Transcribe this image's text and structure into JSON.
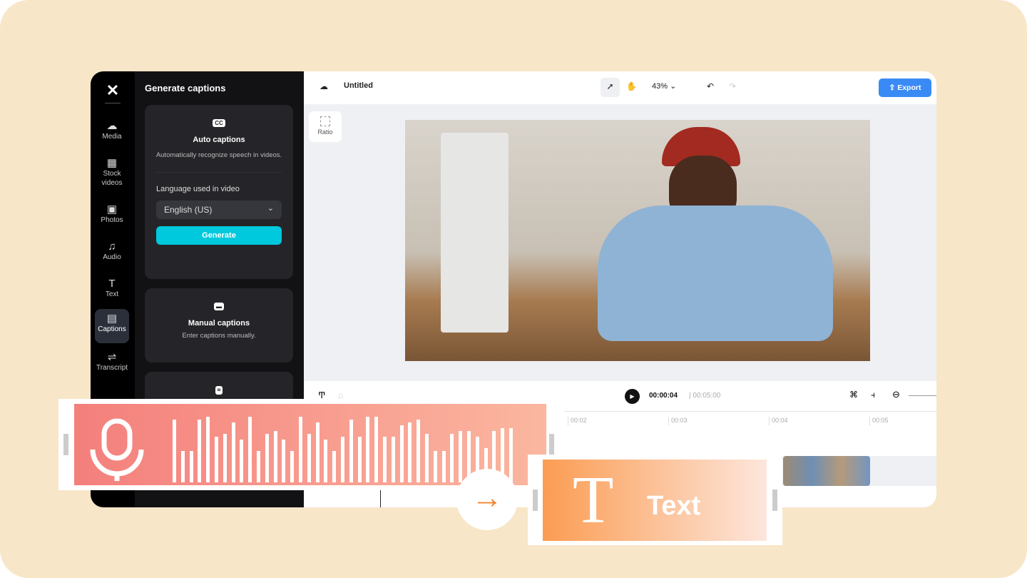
{
  "sidebar": {
    "items": [
      {
        "label": "Media",
        "icon": "cloud-upload-icon"
      },
      {
        "label": "Stock videos",
        "icon": "film-icon"
      },
      {
        "label": "Photos",
        "icon": "image-icon"
      },
      {
        "label": "Audio",
        "icon": "music-icon"
      },
      {
        "label": "Text",
        "icon": "text-icon"
      },
      {
        "label": "Captions",
        "icon": "captions-icon",
        "active": true
      },
      {
        "label": "Transcript",
        "icon": "transcript-icon"
      }
    ]
  },
  "panel": {
    "title": "Generate captions",
    "auto": {
      "title": "Auto captions",
      "desc": "Automatically recognize speech in videos.",
      "lang_label": "Language used in video",
      "lang_value": "English (US)",
      "generate": "Generate"
    },
    "manual": {
      "title": "Manual captions",
      "desc": "Enter captions manually."
    }
  },
  "topbar": {
    "project": "Untitled",
    "zoom": "43%",
    "export": "Export"
  },
  "canvas": {
    "ratio": "Ratio"
  },
  "timeline": {
    "current": "00:00:04",
    "total": "00:05:00",
    "ticks": [
      "00:02",
      "00:03",
      "00:04",
      "00:05"
    ]
  },
  "overlay": {
    "text_label": "Text",
    "accent_red": "#f47f7c",
    "accent_orange": "#fb9c52"
  }
}
